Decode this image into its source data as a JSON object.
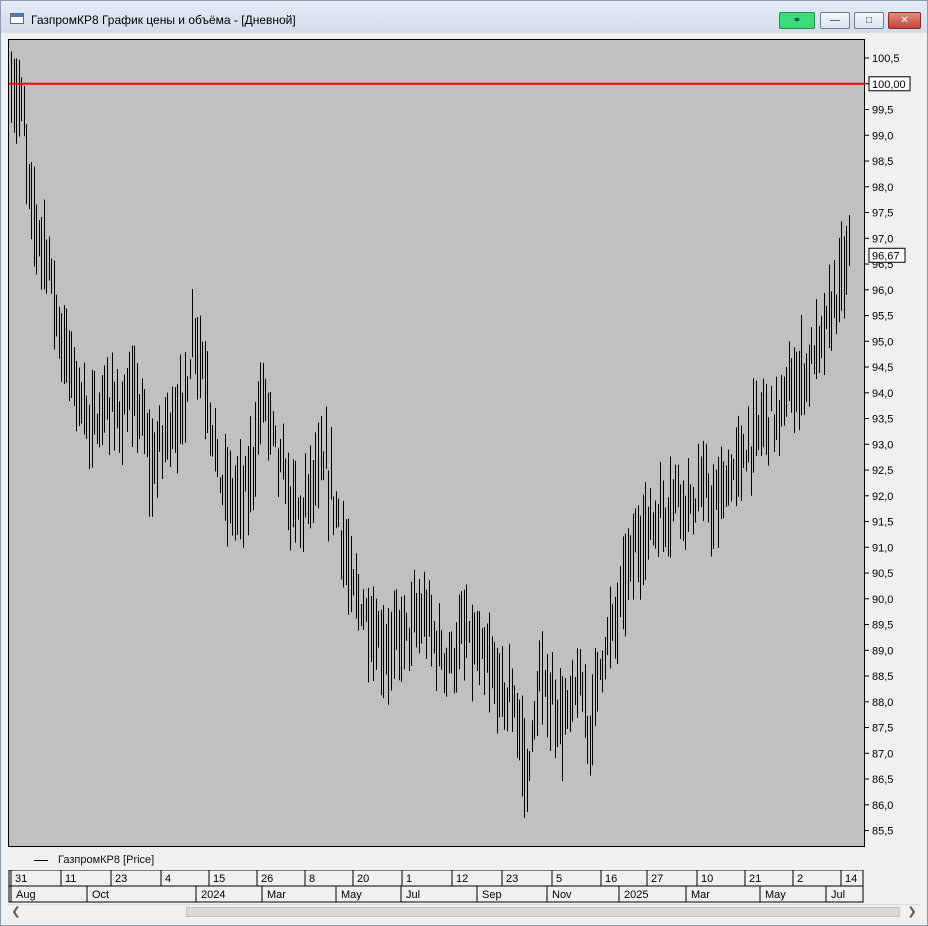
{
  "window": {
    "title": "ГазпромКР8 График цены и объёма - [Дневной]",
    "buttons": {
      "link_icon": "link-icon",
      "min_icon": "minimize-icon",
      "max_icon": "maximize-icon",
      "close_icon": "close-icon"
    }
  },
  "legend": {
    "label": "ГазпромКР8 [Price]"
  },
  "colors": {
    "bars": "#000000",
    "reference_line": "#ff0000",
    "plot_bg": "#c0c0c0"
  },
  "chart_data": {
    "type": "bar",
    "style": "OHLC price bars (daily)",
    "y_axis": {
      "position": "right",
      "ylim": [
        85.2,
        100.85
      ],
      "ticks": [
        "85,5",
        "86,0",
        "86,5",
        "87,0",
        "87,5",
        "88,0",
        "88,5",
        "89,0",
        "89,5",
        "90,0",
        "90,5",
        "91,0",
        "91,5",
        "92,0",
        "92,5",
        "93,0",
        "93,5",
        "94,0",
        "94,5",
        "95,0",
        "95,5",
        "96,0",
        "96,5",
        "97,0",
        "97,5",
        "98,0",
        "98,5",
        "99,0",
        "99,5",
        "100,0",
        "100,5"
      ]
    },
    "reference_line": {
      "value": 100.0,
      "label": "100,00"
    },
    "last_value": {
      "value": 96.67,
      "label": "96,67"
    },
    "x_axis": {
      "days": [
        "31",
        "11",
        "23",
        "4",
        "15",
        "26",
        "8",
        "20",
        "1",
        "12",
        "23",
        "5",
        "16",
        "27",
        "10",
        "21",
        "2",
        "14"
      ],
      "months": [
        "Aug",
        "Oct",
        "2024",
        "Mar",
        "May",
        "Jul",
        "Sep",
        "Nov",
        "2025",
        "Mar",
        "May",
        "Jul"
      ]
    },
    "series": [
      {
        "name": "ГазпромКР8 [Price]",
        "anchors": [
          [
            0,
            99.9
          ],
          [
            4,
            99.6
          ],
          [
            8,
            97.5
          ],
          [
            14,
            96.8
          ],
          [
            20,
            95.0
          ],
          [
            26,
            94.2
          ],
          [
            32,
            93.3
          ],
          [
            38,
            93.8
          ],
          [
            44,
            93.6
          ],
          [
            50,
            93.9
          ],
          [
            56,
            92.5
          ],
          [
            62,
            93.4
          ],
          [
            68,
            93.6
          ],
          [
            73,
            95.3
          ],
          [
            78,
            94.0
          ],
          [
            83,
            92.3
          ],
          [
            88,
            91.9
          ],
          [
            94,
            92.1
          ],
          [
            100,
            94.0
          ],
          [
            105,
            93.0
          ],
          [
            110,
            92.0
          ],
          [
            115,
            91.6
          ],
          [
            120,
            92.3
          ],
          [
            125,
            92.5
          ],
          [
            130,
            91.6
          ],
          [
            135,
            90.2
          ],
          [
            140,
            89.8
          ],
          [
            145,
            89.2
          ],
          [
            150,
            89.0
          ],
          [
            155,
            89.3
          ],
          [
            160,
            89.5
          ],
          [
            165,
            89.6
          ],
          [
            170,
            89.0
          ],
          [
            175,
            88.8
          ],
          [
            180,
            89.3
          ],
          [
            185,
            88.9
          ],
          [
            190,
            88.6
          ],
          [
            195,
            88.2
          ],
          [
            200,
            88.0
          ],
          [
            205,
            86.5
          ],
          [
            210,
            88.3
          ],
          [
            215,
            88.0
          ],
          [
            220,
            87.6
          ],
          [
            225,
            88.3
          ],
          [
            230,
            87.5
          ],
          [
            235,
            89.0
          ],
          [
            240,
            89.5
          ],
          [
            245,
            90.6
          ],
          [
            250,
            91.2
          ],
          [
            255,
            91.5
          ],
          [
            260,
            91.7
          ],
          [
            265,
            92.2
          ],
          [
            270,
            91.8
          ],
          [
            275,
            92.1
          ],
          [
            280,
            91.7
          ],
          [
            285,
            92.3
          ],
          [
            290,
            92.7
          ],
          [
            295,
            93.1
          ],
          [
            300,
            93.6
          ],
          [
            305,
            93.5
          ],
          [
            310,
            94.1
          ],
          [
            315,
            94.4
          ],
          [
            320,
            94.8
          ],
          [
            325,
            95.4
          ],
          [
            330,
            96.2
          ],
          [
            333,
            96.67
          ]
        ]
      }
    ]
  }
}
